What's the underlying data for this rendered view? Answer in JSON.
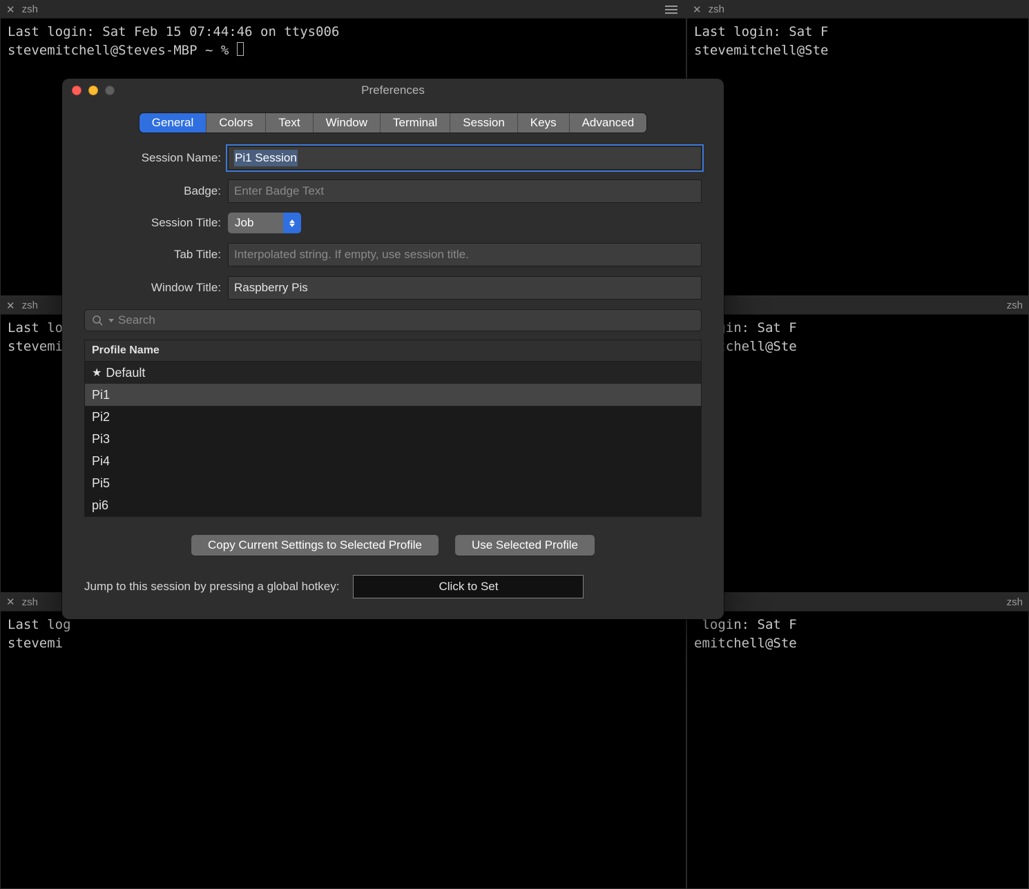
{
  "terminal": {
    "tab_title": "zsh",
    "line1": "Last login: Sat Feb 15 07:44:46 on ttys006",
    "prompt": "stevemitchell@Steves-MBP ~ % ",
    "line1_trunc_right": "Last login: Sat F",
    "prompt_trunc_right": "stevemitchell@Ste",
    "line1_trunc_left": "Last log",
    "prompt_trunc_left": "stevemi",
    "line1_trunc_right2": " login: Sat F",
    "prompt_trunc_right2": "emitchell@Ste"
  },
  "window": {
    "title": "Preferences"
  },
  "tabs": {
    "items": [
      "General",
      "Colors",
      "Text",
      "Window",
      "Terminal",
      "Session",
      "Keys",
      "Advanced"
    ],
    "active_index": 0
  },
  "form": {
    "session_name_label": "Session Name:",
    "session_name_value": "Pi1 Session",
    "badge_label": "Badge:",
    "badge_placeholder": "Enter Badge Text",
    "session_title_label": "Session Title:",
    "session_title_value": "Job",
    "tab_title_label": "Tab Title:",
    "tab_title_placeholder": "Interpolated string. If empty, use session title.",
    "window_title_label": "Window Title:",
    "window_title_value": "Raspberry Pis"
  },
  "search": {
    "placeholder": "Search"
  },
  "profiles": {
    "header": "Profile Name",
    "items": [
      {
        "name": "Default",
        "default": true
      },
      {
        "name": "Pi1",
        "selected": true
      },
      {
        "name": "Pi2"
      },
      {
        "name": "Pi3"
      },
      {
        "name": "Pi4"
      },
      {
        "name": "Pi5"
      },
      {
        "name": "pi6"
      }
    ]
  },
  "buttons": {
    "copy": "Copy Current Settings to Selected Profile",
    "use": "Use Selected Profile"
  },
  "hotkey": {
    "label": "Jump to this session by pressing a global hotkey:",
    "box": "Click to Set"
  }
}
